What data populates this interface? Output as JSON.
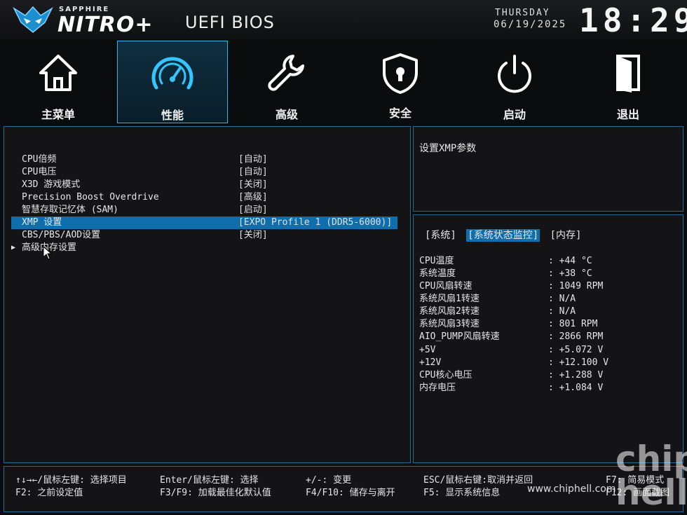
{
  "header": {
    "brand_small": "SAPPHIRE",
    "brand_big": "NITRO+",
    "bios_title": "UEFI BIOS",
    "day": "THURSDAY",
    "date": "06/19/2025",
    "time": "18:29"
  },
  "nav": [
    {
      "label": "主菜单",
      "icon": "home-icon"
    },
    {
      "label": "性能",
      "icon": "speedometer-icon",
      "active": true
    },
    {
      "label": "高级",
      "icon": "wrench-icon"
    },
    {
      "label": "安全",
      "icon": "shield-lock-icon"
    },
    {
      "label": "启动",
      "icon": "power-icon"
    },
    {
      "label": "退出",
      "icon": "exit-door-icon"
    }
  ],
  "menu": [
    {
      "label": "CPU倍频",
      "value": "[自动]"
    },
    {
      "label": "CPU电压",
      "value": "[自动]"
    },
    {
      "label": "X3D 游戏模式",
      "value": "[关闭]"
    },
    {
      "label": "Precision Boost Overdrive",
      "value": "[高级]"
    },
    {
      "label": "智慧存取记忆体 (SAM)",
      "value": "[启动]"
    },
    {
      "label": "XMP 设置",
      "value": "[EXPO Profile 1 (DDR5-6000)]",
      "selected": true
    },
    {
      "label": "CBS/PBS/AOD设置",
      "value": "[关闭]"
    },
    {
      "label": "高级内存设置",
      "value": "",
      "submenu": true
    }
  ],
  "help": {
    "text": "设置XMP参数"
  },
  "monitor": {
    "tabs": [
      {
        "label": "[系统]"
      },
      {
        "label": "[系统状态监控]",
        "active": true
      },
      {
        "label": "[内存]"
      }
    ],
    "rows": [
      {
        "key": "CPU温度",
        "value": ": +44 °C"
      },
      {
        "key": "系统温度",
        "value": ": +38 °C"
      },
      {
        "key": "CPU风扇转速",
        "value": ": 1049 RPM"
      },
      {
        "key": "系统风扇1转速",
        "value": ": N/A"
      },
      {
        "key": "系统风扇2转速",
        "value": ": N/A"
      },
      {
        "key": "系统风扇3转速",
        "value": ": 801 RPM"
      },
      {
        "key": "AIO_PUMP风扇转速",
        "value": ": 2866 RPM"
      },
      {
        "key": "+5V",
        "value": ": +5.072 V"
      },
      {
        "key": "+12V",
        "value": ": +12.100 V"
      },
      {
        "key": "CPU核心电压",
        "value": ": +1.288 V"
      },
      {
        "key": "内存电压",
        "value": ": +1.084 V"
      }
    ]
  },
  "footer": {
    "r1": [
      "↑↓→←/鼠标左键: 选择项目",
      "Enter/鼠标左键: 选择",
      "+/-: 变更",
      "ESC/鼠标右键:取消并返回",
      "F7: 简易模式"
    ],
    "r2": [
      "F2: 之前设定值",
      "F3/F9: 加载最佳化默认值",
      "F4/F10: 储存与离开",
      "F5: 显示系统信息",
      "F12: 画面截图"
    ]
  },
  "watermark": {
    "brand": "chip hell",
    "url": "www.chiphell.com"
  },
  "colors": {
    "accent": "#29b6e6",
    "selection": "#0f6fad",
    "panel_border": "#1e6f93"
  }
}
